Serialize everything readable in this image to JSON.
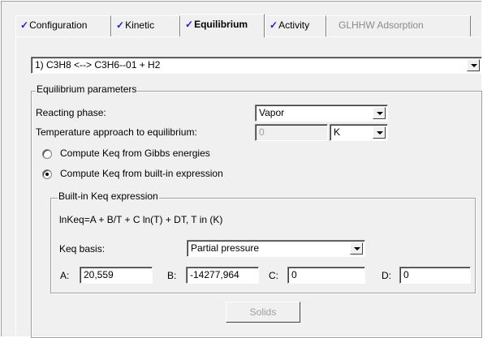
{
  "tabs": [
    {
      "label": "Configuration",
      "checked": true
    },
    {
      "label": "Kinetic",
      "checked": true
    },
    {
      "label": "Equilibrium",
      "checked": true,
      "active": true
    },
    {
      "label": "Activity",
      "checked": true
    },
    {
      "label": "GLHHW Adsorption",
      "checked": false,
      "disabled": true
    }
  ],
  "check_glyph": "✓",
  "reaction_select": {
    "value": "1) C3H8 <--> C3H6--01 + H2"
  },
  "equilibrium": {
    "group_title": "Equilibrium parameters",
    "reacting_phase_label": "Reacting phase:",
    "reacting_phase_value": "Vapor",
    "temp_approach_label": "Temperature approach to equilibrium:",
    "temp_approach_value": "0",
    "temp_unit": "K",
    "radio_gibbs_label": "Compute Keq from Gibbs energies",
    "radio_gibbs_checked": false,
    "radio_builtin_label": "Compute Keq from built-in expression",
    "radio_builtin_checked": true
  },
  "builtin": {
    "group_title": "Built-in Keq expression",
    "formula": "lnKeq=A + B/T + C ln(T) + DT, T in (K)",
    "basis_label": "Keq basis:",
    "basis_value": "Partial pressure",
    "a_label": "A:",
    "a_value": "20,559",
    "b_label": "B:",
    "b_value": "-14277,964",
    "c_label": "C:",
    "c_value": "0",
    "d_label": "D:",
    "d_value": "0"
  },
  "solids_button": "Solids"
}
